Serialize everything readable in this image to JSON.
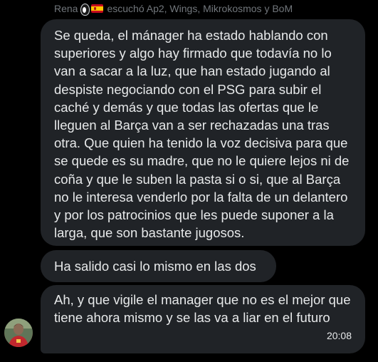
{
  "header": {
    "sender_name": "Rena",
    "status_text": "escuchó Ap2, Wings, Mikrokosmos y BoM",
    "emojis": [
      "penguin-icon",
      "spain-flag-icon"
    ]
  },
  "messages": [
    {
      "text": "Se queda, el mánager ha estado hablando con superiores y algo hay firmado que todavía no lo van a sacar a la luz, que han estado jugando al despiste negociando con el PSG para subir el caché y demás y que todas las ofertas que le lleguen al Barça van a ser rechazadas una tras otra. Que quien ha tenido la voz decisiva para que se quede es su madre, que no le quiere lejos ni de coña y que le suben la pasta si o si, que al Barça no le interesa venderlo por la falta de un delantero y por los patrocinios que les puede suponer a la larga, que son bastante jugosos."
    },
    {
      "text": "Ha salido casi lo mismo en las dos"
    },
    {
      "text": "Ah, y que vigile el manager que no es el mejor que tiene ahora mismo y se las va a liar en el futuro",
      "time": "20:08"
    }
  ],
  "colors": {
    "background": "#000000",
    "bubble": "#202327",
    "text": "#e7e9ea",
    "meta_text": "#71767b"
  }
}
